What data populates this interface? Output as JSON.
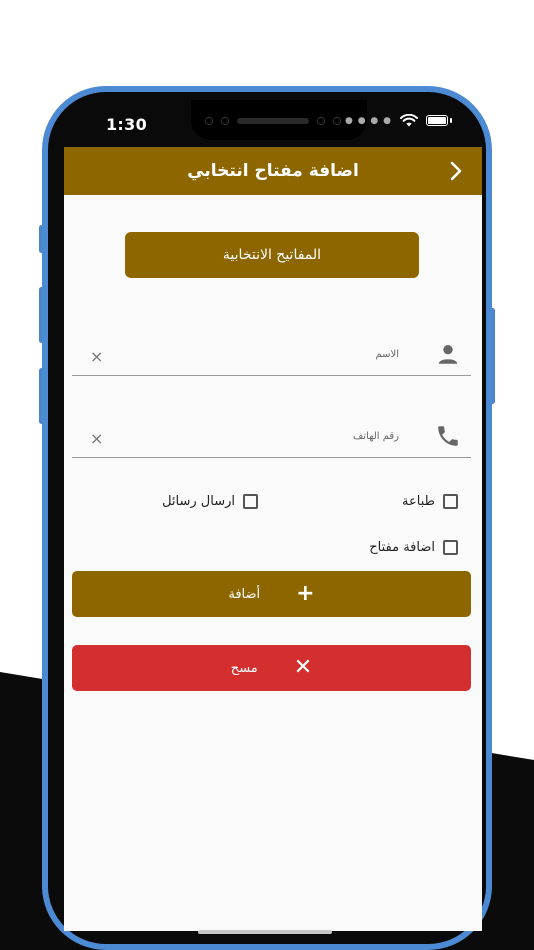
{
  "status": {
    "time": "1:30"
  },
  "appbar": {
    "title": "اضافة مفتاح انتخابي"
  },
  "keys_button": {
    "label": "المفاتيح الانتخابية"
  },
  "name_field": {
    "placeholder": "الاسم",
    "clear": "×"
  },
  "phone_field": {
    "placeholder": "رقم الهاتف",
    "clear": "×"
  },
  "checkboxes": {
    "print": "طباعة",
    "send_messages": "ارسال رسائل",
    "add_key": "اضافة مفتاح"
  },
  "add_button": {
    "label": "أضافة",
    "icon": "+"
  },
  "clear_button": {
    "label": "مسح",
    "icon": "✕"
  },
  "colors": {
    "primary": "#8d6600",
    "danger": "#d32f2f",
    "frame": "#4d8ad4"
  }
}
